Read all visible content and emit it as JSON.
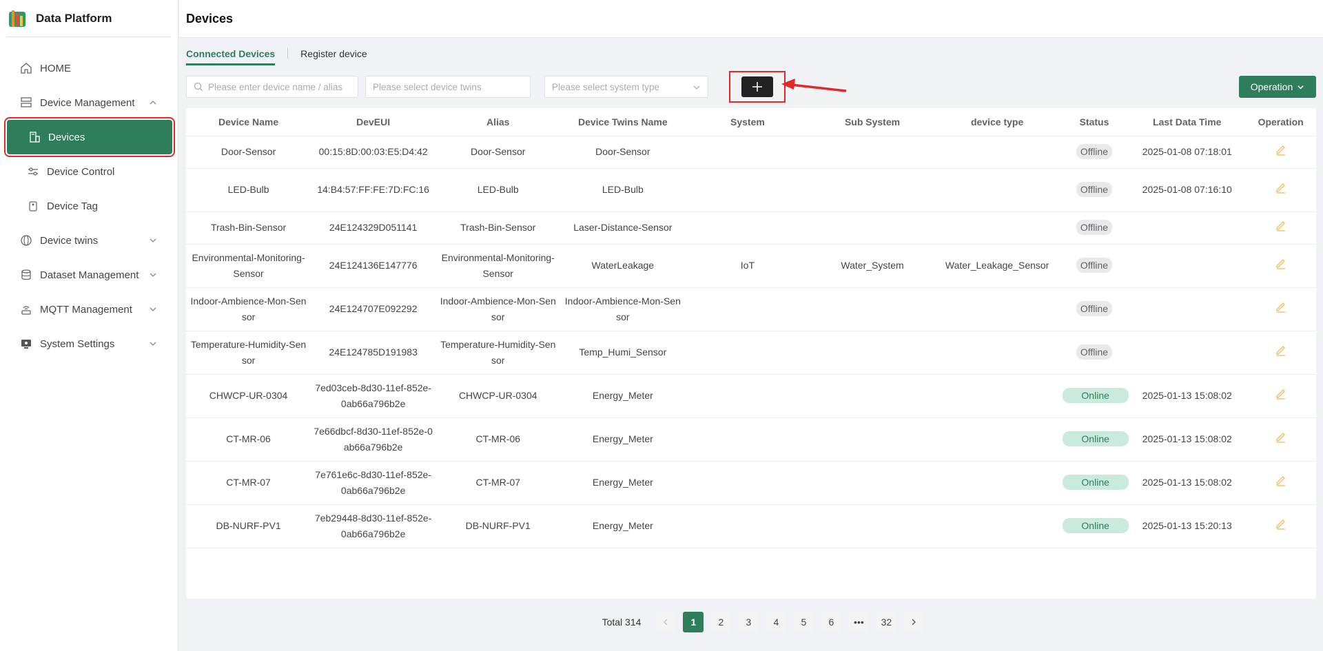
{
  "app": {
    "title": "Data Platform"
  },
  "sidebar": {
    "items": [
      {
        "label": "HOME",
        "icon": "home-icon"
      },
      {
        "label": "Device Management",
        "icon": "server-icon",
        "expanded": true
      },
      {
        "label": "Devices",
        "icon": "devices-icon",
        "active": true
      },
      {
        "label": "Device Control",
        "icon": "sliders-icon"
      },
      {
        "label": "Device Tag",
        "icon": "tag-icon"
      },
      {
        "label": "Device twins",
        "icon": "globe-icon"
      },
      {
        "label": "Dataset Management",
        "icon": "database-icon"
      },
      {
        "label": "MQTT Management",
        "icon": "wireless-icon"
      },
      {
        "label": "System Settings",
        "icon": "monitor-icon"
      }
    ]
  },
  "page": {
    "title": "Devices"
  },
  "tabs": [
    {
      "label": "Connected Devices",
      "active": true
    },
    {
      "label": "Register device",
      "active": false
    }
  ],
  "filters": {
    "search_placeholder": "Please enter device name / alias",
    "twins_placeholder": "Please select device twins",
    "system_placeholder": "Please select system type",
    "add_label": "+",
    "operation_label": "Operation"
  },
  "table": {
    "columns": [
      "Device Name",
      "DevEUI",
      "Alias",
      "Device Twins Name",
      "System",
      "Sub System",
      "device type",
      "Status",
      "Last Data Time",
      "Operation"
    ],
    "rows": [
      {
        "name": "Door-Sensor",
        "deveui": "00:15:8D:00:03:E5:D4:42",
        "alias": "Door-Sensor",
        "twins": "Door-Sensor",
        "system": "",
        "subsystem": "",
        "type": "",
        "status": "Offline",
        "last": "2025-01-08 07:18:01"
      },
      {
        "name": "LED-Bulb",
        "deveui": "14:B4:57:FF:FE:7D:FC:16",
        "alias": "LED-Bulb",
        "twins": "LED-Bulb",
        "system": "",
        "subsystem": "",
        "type": "",
        "status": "Offline",
        "last": "2025-01-08 07:16:10"
      },
      {
        "name": "Trash-Bin-Sensor",
        "deveui": "24E124329D051141",
        "alias": "Trash-Bin-Sensor",
        "twins": "Laser-Distance-Sensor",
        "system": "",
        "subsystem": "",
        "type": "",
        "status": "Offline",
        "last": ""
      },
      {
        "name": "Environmental-Monitoring-Sensor",
        "deveui": "24E124136E147776",
        "alias": "Environmental-Monitoring-Sensor",
        "twins": "WaterLeakage",
        "system": "IoT",
        "subsystem": "Water_System",
        "type": "Water_Leakage_Sensor",
        "status": "Offline",
        "last": ""
      },
      {
        "name": "Indoor-Ambience-Mon-Sensor",
        "deveui": "24E124707E092292",
        "alias": "Indoor-Ambience-Mon-Sensor",
        "twins": "Indoor-Ambience-Mon-Sensor",
        "system": "",
        "subsystem": "",
        "type": "",
        "status": "Offline",
        "last": ""
      },
      {
        "name": "Temperature-Humidity-Sensor",
        "deveui": "24E124785D191983",
        "alias": "Temperature-Humidity-Sensor",
        "twins": "Temp_Humi_Sensor",
        "system": "",
        "subsystem": "",
        "type": "",
        "status": "Offline",
        "last": ""
      },
      {
        "name": "CHWCP-UR-0304",
        "deveui": "7ed03ceb-8d30-11ef-852e-0ab66a796b2e",
        "alias": "CHWCP-UR-0304",
        "twins": "Energy_Meter",
        "system": "",
        "subsystem": "",
        "type": "",
        "status": "Online",
        "last": "2025-01-13 15:08:02"
      },
      {
        "name": "CT-MR-06",
        "deveui": "7e66dbcf-8d30-11ef-852e-0ab66a796b2e",
        "alias": "CT-MR-06",
        "twins": "Energy_Meter",
        "system": "",
        "subsystem": "",
        "type": "",
        "status": "Online",
        "last": "2025-01-13 15:08:02"
      },
      {
        "name": "CT-MR-07",
        "deveui": "7e761e6c-8d30-11ef-852e-0ab66a796b2e",
        "alias": "CT-MR-07",
        "twins": "Energy_Meter",
        "system": "",
        "subsystem": "",
        "type": "",
        "status": "Online",
        "last": "2025-01-13 15:08:02"
      },
      {
        "name": "DB-NURF-PV1",
        "deveui": "7eb29448-8d30-11ef-852e-0ab66a796b2e",
        "alias": "DB-NURF-PV1",
        "twins": "Energy_Meter",
        "system": "",
        "subsystem": "",
        "type": "",
        "status": "Online",
        "last": "2025-01-13 15:20:13"
      }
    ]
  },
  "pagination": {
    "total": "Total 314",
    "pages": [
      "1",
      "2",
      "3",
      "4",
      "5",
      "6",
      "•••",
      "32"
    ],
    "current": "1"
  },
  "colors": {
    "primary": "#2e7d5b",
    "highlight": "#e02a2a"
  }
}
